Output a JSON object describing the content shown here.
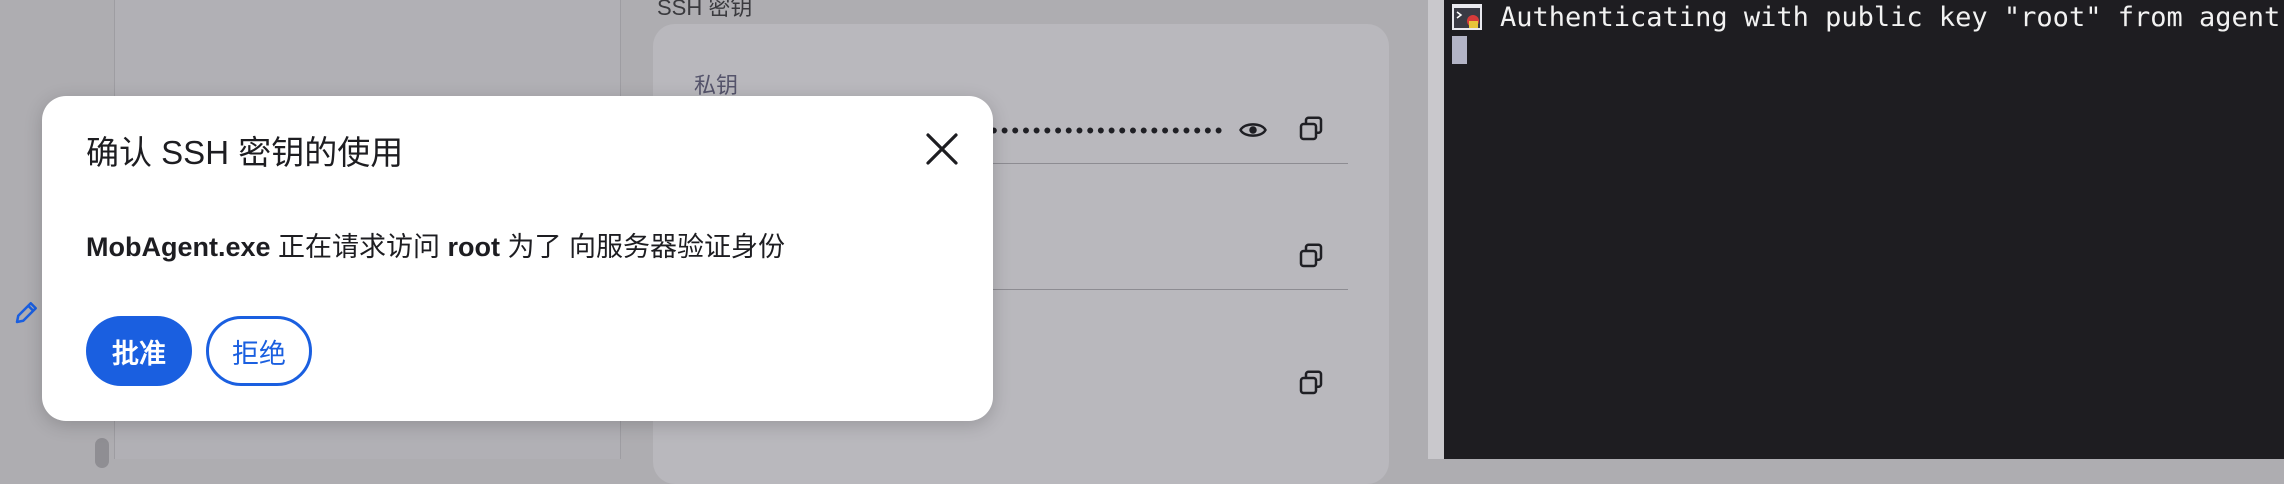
{
  "background_app": {
    "section_title": "SSH 密钥",
    "private_key_label": "私钥",
    "private_key_mask": "•••••••••••••••••••••••",
    "icons": [
      "pencil-icon",
      "eye-icon",
      "copy-icon"
    ]
  },
  "terminal": {
    "line1": "Authenticating with public key \"root\" from agent"
  },
  "dialog": {
    "title": "确认 SSH 密钥的使用",
    "message": {
      "app_name": "MobAgent.exe",
      "text_1": " 正在请求访问 ",
      "key_name": "root",
      "text_2": " 为了 向服务器验证身份"
    },
    "approve_label": "批准",
    "reject_label": "拒绝"
  },
  "colors": {
    "accent": "#1a5fe0",
    "overlay_dim": "#aeadb1",
    "terminal_bg": "#1e1d21"
  }
}
